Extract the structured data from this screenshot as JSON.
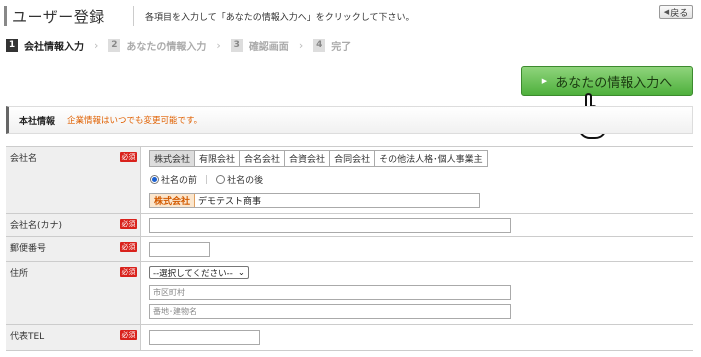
{
  "header": {
    "title": "ユーザー登録",
    "instruction": "各項目を入力して「あなたの情報入力へ」をクリックして下さい。",
    "back_label": "戻る"
  },
  "steps": [
    {
      "num": "1",
      "label": "会社情報入力",
      "active": true
    },
    {
      "num": "2",
      "label": "あなたの情報入力",
      "active": false
    },
    {
      "num": "3",
      "label": "確認画面",
      "active": false
    },
    {
      "num": "4",
      "label": "完了",
      "active": false
    }
  ],
  "next_button": {
    "label": "あなたの情報入力へ"
  },
  "section": {
    "title": "本社情報",
    "note": "企業情報はいつでも変更可能です。"
  },
  "required_label": "必須",
  "form": {
    "company_name": {
      "label": "会社名",
      "types": [
        "株式会社",
        "有限会社",
        "合名会社",
        "合資会社",
        "合同会社",
        "その他法人格･個人事業主"
      ],
      "position_before": "社名の前",
      "position_after": "社名の後",
      "prefix": "株式会社",
      "value": "デモテスト商事"
    },
    "company_kana": {
      "label": "会社名(カナ)",
      "value": ""
    },
    "postal_code": {
      "label": "郵便番号",
      "value": ""
    },
    "address": {
      "label": "住所",
      "select_value": "--選択してください--",
      "city_placeholder": "市区町村",
      "street_placeholder": "番地･建物名"
    },
    "phone": {
      "label": "代表TEL",
      "value": ""
    }
  },
  "colors": {
    "accent_green": "#4eb03c",
    "required_red": "#d9221c",
    "note_orange": "#e06000"
  }
}
